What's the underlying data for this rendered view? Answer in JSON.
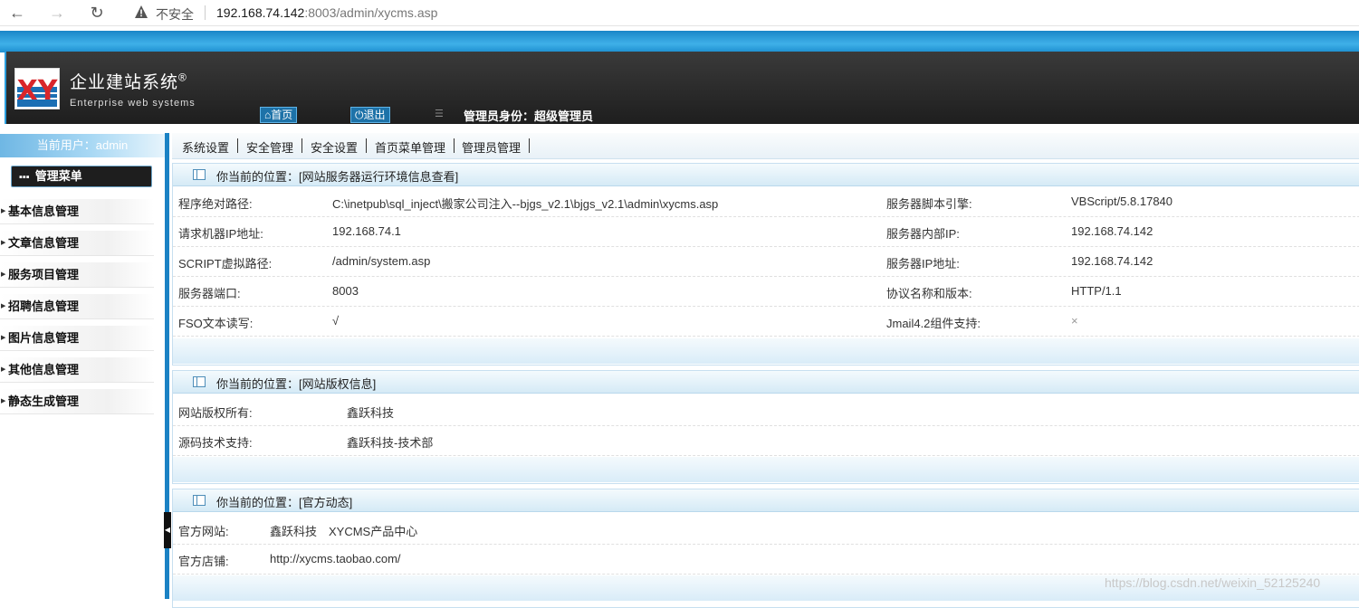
{
  "browser": {
    "back_icon": "←",
    "forward_icon": "→",
    "reload_icon": "↻",
    "insecure_label": "不安全",
    "url_host": "192.168.74.142",
    "url_rest": ":8003/admin/xycms.asp"
  },
  "header": {
    "logo_text": "XY",
    "brand_title": "企业建站系统",
    "brand_reg": "®",
    "brand_subtitle": "Enterprise web systems",
    "home_label": "首页",
    "logout_label": "退出",
    "role_text": "管理员身份：超级管理员"
  },
  "sidebar": {
    "current_user": "当前用户：admin",
    "menu_title": "管理菜单",
    "items": [
      {
        "label": "基本信息管理"
      },
      {
        "label": "文章信息管理"
      },
      {
        "label": "服务项目管理"
      },
      {
        "label": "招聘信息管理"
      },
      {
        "label": "图片信息管理"
      },
      {
        "label": "其他信息管理"
      },
      {
        "label": "静态生成管理"
      }
    ]
  },
  "topmenu": {
    "items": [
      {
        "label": "系统设置"
      },
      {
        "label": "安全管理"
      },
      {
        "label": "安全设置"
      },
      {
        "label": "首页菜单管理"
      },
      {
        "label": "管理员管理"
      }
    ]
  },
  "panels": {
    "server": {
      "title": "你当前的位置：[网站服务器运行环境信息查看]",
      "rows": [
        {
          "k1": "程序绝对路径:",
          "v1": "C:\\inetpub\\sql_inject\\搬家公司注入--bjgs_v2.1\\bjgs_v2.1\\admin\\xycms.asp",
          "k2": "服务器脚本引擎:",
          "v2": "VBScript/5.8.17840"
        },
        {
          "k1": "请求机器IP地址:",
          "v1": "192.168.74.1",
          "k2": "服务器内部IP:",
          "v2": "192.168.74.142"
        },
        {
          "k1": "SCRIPT虚拟路径:",
          "v1": "/admin/system.asp",
          "k2": "服务器IP地址:",
          "v2": "192.168.74.142"
        },
        {
          "k1": "服务器端口:",
          "v1": "8003",
          "k2": "协议名称和版本:",
          "v2": "HTTP/1.1"
        },
        {
          "k1": "FSO文本读写:",
          "v1": "√",
          "k2": "Jmail4.2组件支持:",
          "v2": "×"
        }
      ]
    },
    "copyright": {
      "title": "你当前的位置：[网站版权信息]",
      "rows": [
        {
          "k": "网站版权所有:",
          "v": "鑫跃科技"
        },
        {
          "k": "源码技术支持:",
          "v": "鑫跃科技-技术部"
        }
      ]
    },
    "official": {
      "title": "你当前的位置：[官方动态]",
      "rows": [
        {
          "k": "官方网站:",
          "v": "鑫跃科技　XYCMS产品中心"
        },
        {
          "k": "官方店铺:",
          "v": "http://xycms.taobao.com/"
        }
      ]
    }
  },
  "watermark": "https://blog.csdn.net/weixin_52125240"
}
